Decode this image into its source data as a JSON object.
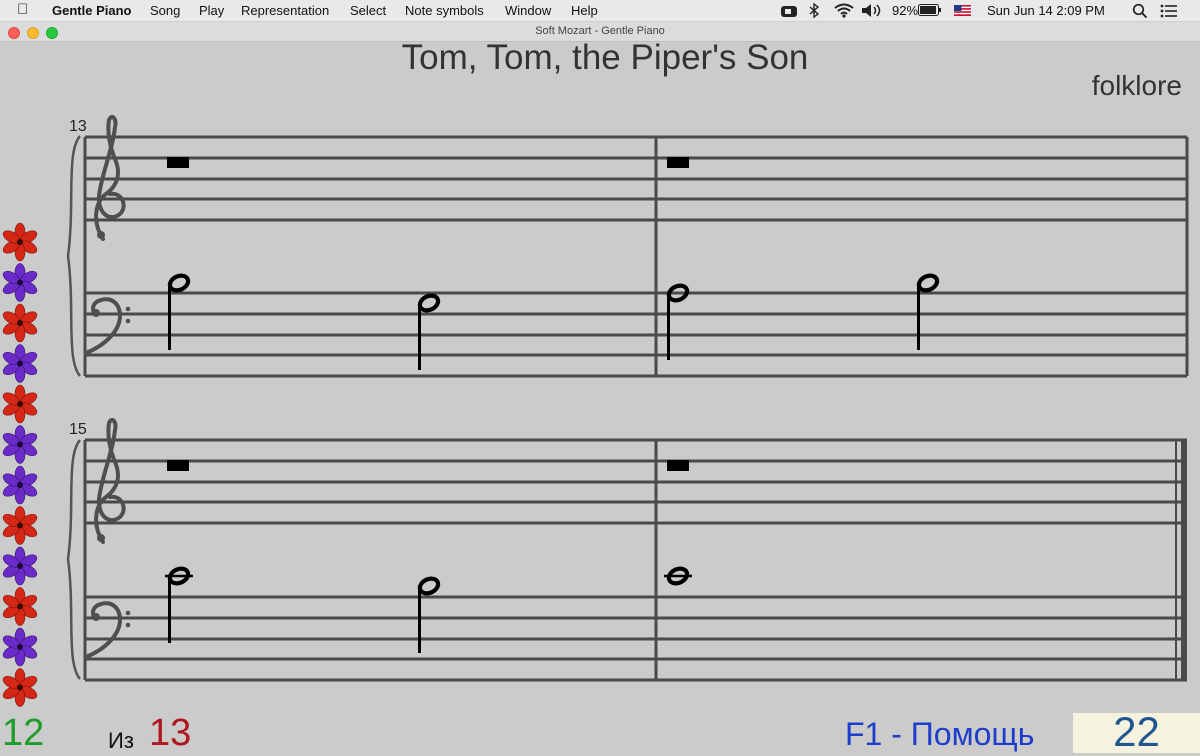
{
  "menubar": {
    "apple_icon": "apple-logo",
    "app_name": "Gentle Piano",
    "items": [
      "Song",
      "Play",
      "Representation",
      "Select",
      "Note symbols",
      "Window",
      "Help"
    ],
    "battery_percent": "92%",
    "datetime": "Sun Jun 14  2:09 PM"
  },
  "window": {
    "title": "Soft Mozart - Gentle Piano"
  },
  "song": {
    "title": "Tom, Tom, the Piper's Son",
    "composer": "folklore"
  },
  "systems": [
    {
      "measure_number": "13"
    },
    {
      "measure_number": "15"
    }
  ],
  "flowers": [
    "red",
    "purple",
    "red",
    "purple",
    "red",
    "purple",
    "purple",
    "red",
    "purple",
    "red",
    "purple",
    "red"
  ],
  "colors": {
    "flower_red": "#d42716",
    "flower_purple": "#6a2bc8",
    "counter_bg": "#f6f2e0",
    "help_blue": "#1d3dcc"
  },
  "footer": {
    "current_page": "12",
    "of_label": "Из",
    "total_pages": "13",
    "help": "F1 - Помощь",
    "counter": "22"
  }
}
